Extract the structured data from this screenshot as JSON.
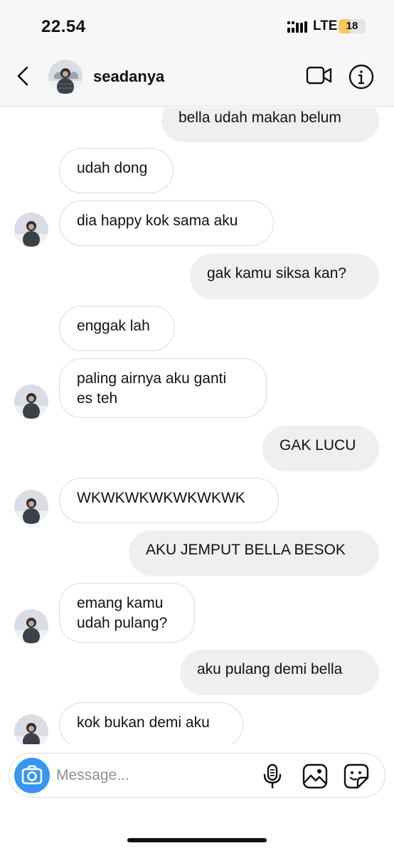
{
  "status_bar": {
    "time": "22.54",
    "network": "LTE",
    "battery": "18",
    "battery_level": 0.18
  },
  "header": {
    "username": "seadanya",
    "avatar_icon": "profile-photo-icon"
  },
  "messages": [
    {
      "side": "out",
      "text": "bella udah makan belum"
    },
    {
      "side": "in",
      "text": "udah dong"
    },
    {
      "side": "in",
      "text": "dia happy kok sama aku"
    },
    {
      "side": "out",
      "text": "gak kamu siksa kan?"
    },
    {
      "side": "in",
      "text": "enggak lah"
    },
    {
      "side": "in",
      "text": "paling airnya aku ganti\nes teh"
    },
    {
      "side": "out",
      "text": "GAK LUCU"
    },
    {
      "side": "in",
      "text": "WKWKWKWKWKWKWK"
    },
    {
      "side": "out",
      "text": "AKU JEMPUT BELLA BESOK"
    },
    {
      "side": "in",
      "text": "emang kamu\nudah pulang?"
    },
    {
      "side": "out",
      "text": "aku pulang demi bella"
    },
    {
      "side": "in",
      "text": "kok bukan demi aku"
    }
  ],
  "composer": {
    "placeholder": "Message..."
  },
  "colors": {
    "accent": "#3797f0",
    "incoming_border": "#dbdbdb",
    "outgoing_bg": "#efefef"
  }
}
